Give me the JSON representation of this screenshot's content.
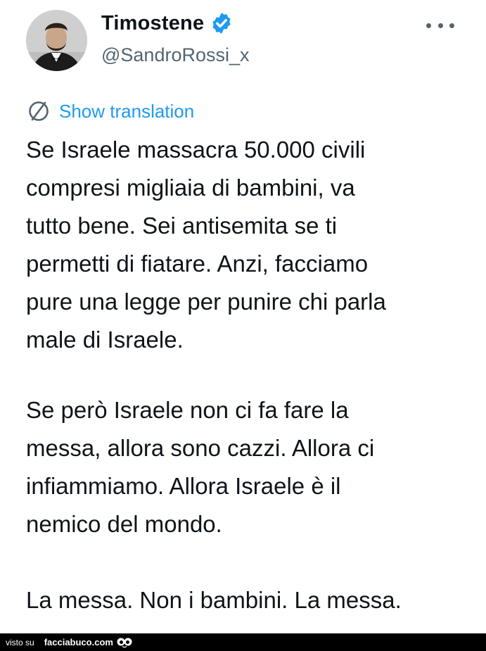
{
  "tweet": {
    "display_name": "Timostene",
    "handle": "@SandroRossi_x",
    "translate_label": "Show translation",
    "paragraphs": [
      "Se Israele massacra 50.000 civili\ncompresi migliaia di bambini, va\ntutto bene. Sei antisemita se ti\npermetti di fiatare. Anzi, facciamo\npure una legge per punire chi parla\nmale di Israele.",
      "Se però Israele non ci fa fare la\nmessa, allora sono cazzi. Allora ci\ninfiammiamo. Allora Israele è il\nnemico del mondo.",
      "La messa. Non i bambini. La messa."
    ]
  },
  "icons": {
    "verified": "verified-badge-icon",
    "more": "more-options-icon",
    "translate": "globe-icon",
    "footer_logo": "facciabuco-logo-icon"
  },
  "colors": {
    "accent": "#1d9bf0",
    "secondary_text": "#536471",
    "text": "#0f1419",
    "footer_bg": "#000000"
  },
  "footer": {
    "visto_su": "visto su",
    "site": "facciabuco.com"
  }
}
